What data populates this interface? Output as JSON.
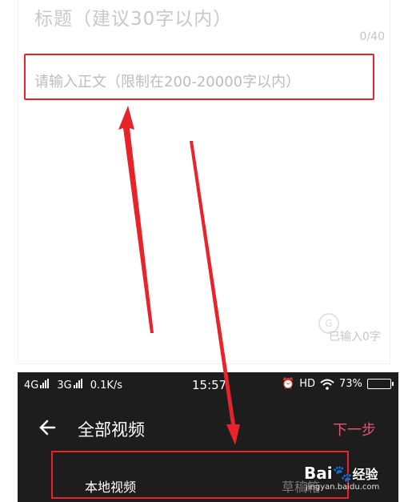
{
  "editor": {
    "title_placeholder": "标题（建议30字以内）",
    "title_counter": "0/40",
    "body_placeholder": "请输入正文（限制在200-20000字以内）",
    "char_count": "已输入0字"
  },
  "phone": {
    "status": {
      "network1": "4G",
      "network2": "3G",
      "speed": "0.1K/s",
      "time": "15:57",
      "hd": "HD",
      "battery": "73%"
    },
    "nav": {
      "title": "全部视频",
      "next": "下一步"
    },
    "tabs": {
      "local": "本地视频",
      "draft": "草稿箱"
    }
  },
  "watermark": {
    "brand": "Bai",
    "brand_suffix": "经验",
    "url": "jingyan.baidu.com"
  },
  "colors": {
    "highlight": "#e8232a",
    "accent_next": "#e8527a",
    "phone_bg": "#1d1d1d"
  }
}
